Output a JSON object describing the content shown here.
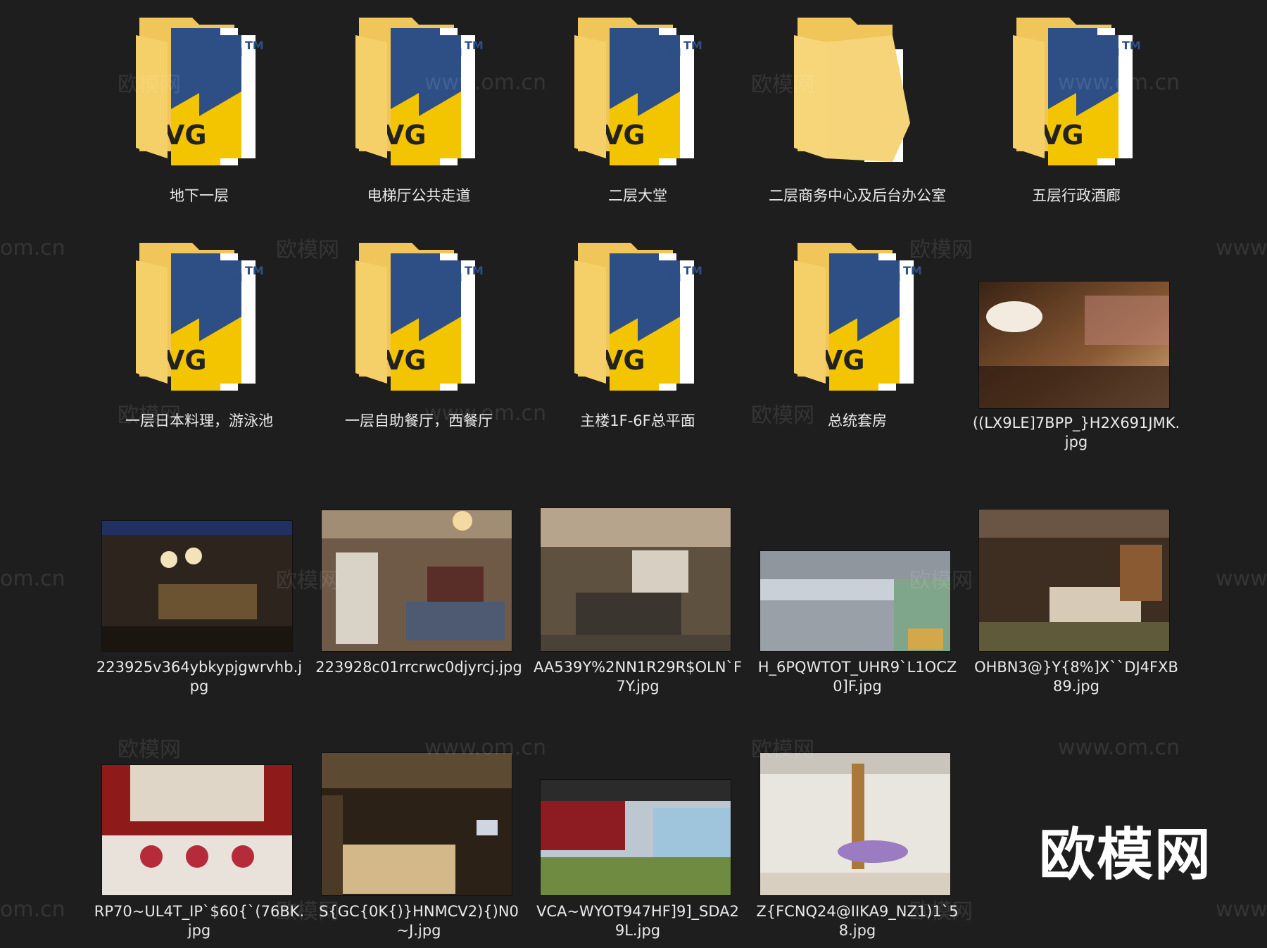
{
  "folders": [
    {
      "name": "地下一层"
    },
    {
      "name": "电梯厅公共走道"
    },
    {
      "name": "二层大堂"
    },
    {
      "name": "二层商务中心及后台办公室"
    },
    {
      "name": "五层行政酒廊"
    },
    {
      "name": "一层日本料理，游泳池"
    },
    {
      "name": "一层自助餐厅，西餐厅"
    },
    {
      "name": "主楼1F-6F总平面"
    },
    {
      "name": "总统套房"
    }
  ],
  "folder_badge": {
    "tm": "TM",
    "dwg": "VG"
  },
  "images": [
    {
      "name": "((LX9LE]7BPP_}H2X691JMK.jpg"
    },
    {
      "name": "223925v364ybkypjgwrvhb.jpg"
    },
    {
      "name": "223928c01rrcrwc0djyrcj.jpg"
    },
    {
      "name": "AA539Y%2NN1R29R$OLN`F7Y.jpg"
    },
    {
      "name": "H_6PQWTOT_UHR9`L1OCZ0]F.jpg"
    },
    {
      "name": "OHBN3@}Y{8%]X``DJ4FXB89.jpg"
    },
    {
      "name": "RP70~UL4T_IP`$60{`(76BK.jpg"
    },
    {
      "name": "S{GC{0K{)}HNMCV2){)N0~J.jpg"
    },
    {
      "name": "VCA~WYOT947HF]9]_SDA29L.jpg"
    },
    {
      "name": "Z{FCNQ24@IIKA9_NZ1)1`58.jpg"
    }
  ],
  "watermarks": {
    "site": "www.om.cn",
    "site_short": "om.cn",
    "cn": "欧模网"
  },
  "brand": "欧模网",
  "colors": {
    "background": "#1e1e1e",
    "folder": "#f4cf6a",
    "dwg_blue": "#2d4f86",
    "dwg_yellow": "#f2c500"
  }
}
